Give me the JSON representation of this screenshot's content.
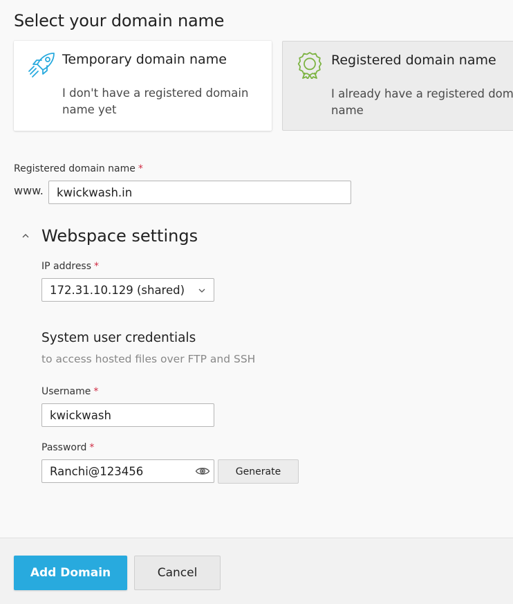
{
  "page_title": "Select your domain name",
  "domain_options": [
    {
      "title": "Temporary domain name",
      "description": "I don't have a registered domain name yet",
      "icon": "rocket-icon",
      "selected": false
    },
    {
      "title": "Registered domain name",
      "description_line1": "I already have a registered domain",
      "description_line2": "name",
      "icon": "award-badge-icon",
      "selected": true
    }
  ],
  "registered_domain": {
    "label": "Registered domain name",
    "required_mark": "*",
    "prefix": "www.",
    "value": "kwickwash.in"
  },
  "webspace": {
    "title": "Webspace settings",
    "expanded": true,
    "ip_address": {
      "label": "IP address",
      "required_mark": "*",
      "selected": "172.31.10.129 (shared)"
    },
    "credentials": {
      "title": "System user credentials",
      "subtitle": "to access hosted files over FTP and SSH",
      "username": {
        "label": "Username",
        "required_mark": "*",
        "value": "kwickwash"
      },
      "password": {
        "label": "Password",
        "required_mark": "*",
        "value": "Ranchi@123456",
        "generate_label": "Generate"
      }
    }
  },
  "footer": {
    "primary_label": "Add Domain",
    "cancel_label": "Cancel"
  },
  "colors": {
    "primary": "#28aade",
    "icon_blue": "#28aade",
    "icon_green": "#7cb342",
    "required": "#d02c44"
  }
}
